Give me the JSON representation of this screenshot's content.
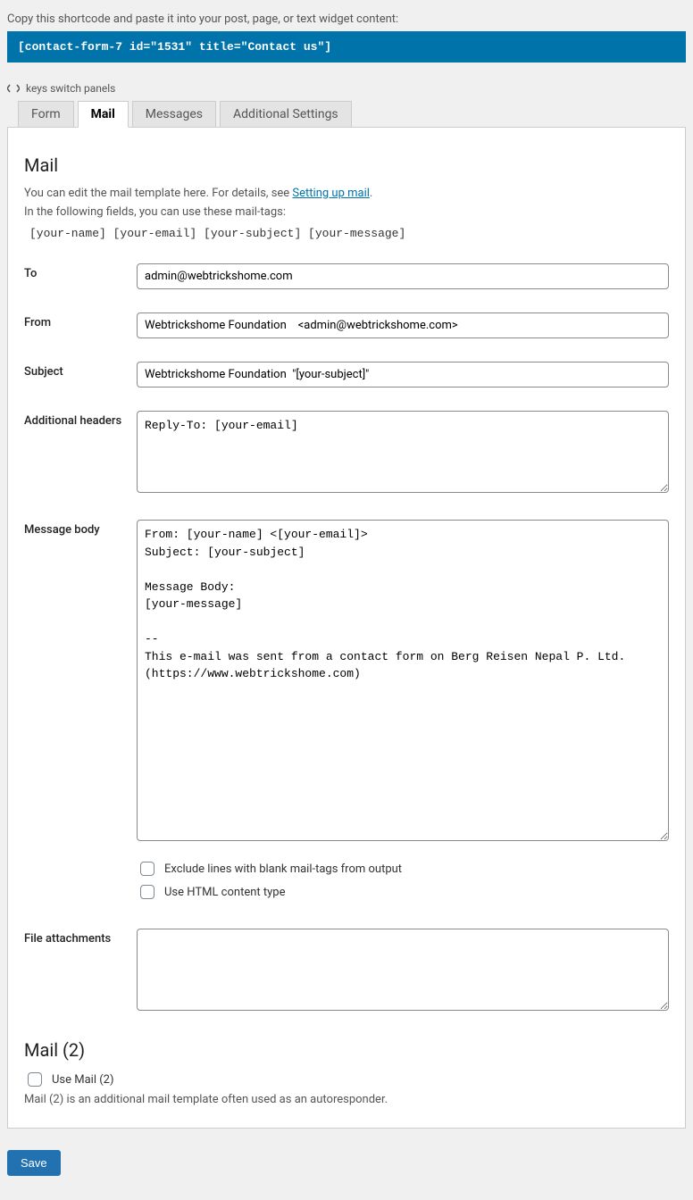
{
  "shortcode": {
    "label": "Copy this shortcode and paste it into your post, page, or text widget content:",
    "code": "[contact-form-7 id=\"1531\" title=\"Contact us\"]"
  },
  "keys_hint": "keys switch panels",
  "tabs": {
    "form": "Form",
    "mail": "Mail",
    "messages": "Messages",
    "additional": "Additional Settings"
  },
  "mail": {
    "title": "Mail",
    "intro1_prefix": "You can edit the mail template here. For details, see ",
    "intro1_link": "Setting up mail",
    "intro1_suffix": ".",
    "intro2": "In the following fields, you can use these mail-tags:",
    "mailtags": "[your-name] [your-email] [your-subject] [your-message]",
    "fields": {
      "to": {
        "label": "To",
        "value": "admin@webtrickshome.com"
      },
      "from": {
        "label": "From",
        "value": "Webtrickshome Foundation    <admin@webtrickshome.com>"
      },
      "subject": {
        "label": "Subject",
        "value": "Webtrickshome Foundation  \"[your-subject]\""
      },
      "headers": {
        "label": "Additional headers",
        "value": "Reply-To: [your-email]"
      },
      "body": {
        "label": "Message body",
        "value": "From: [your-name] <[your-email]>\nSubject: [your-subject]\n\nMessage Body:\n[your-message]\n\n-- \nThis e-mail was sent from a contact form on Berg Reisen Nepal P. Ltd. (https://www.webtrickshome.com)"
      },
      "attachments": {
        "label": "File attachments",
        "value": ""
      }
    },
    "options": {
      "exclude_blank": "Exclude lines with blank mail-tags from output",
      "use_html": "Use HTML content type"
    }
  },
  "mail2": {
    "title": "Mail (2)",
    "use_label": "Use Mail (2)",
    "hint": "Mail (2) is an additional mail template often used as an autoresponder."
  },
  "save": "Save"
}
